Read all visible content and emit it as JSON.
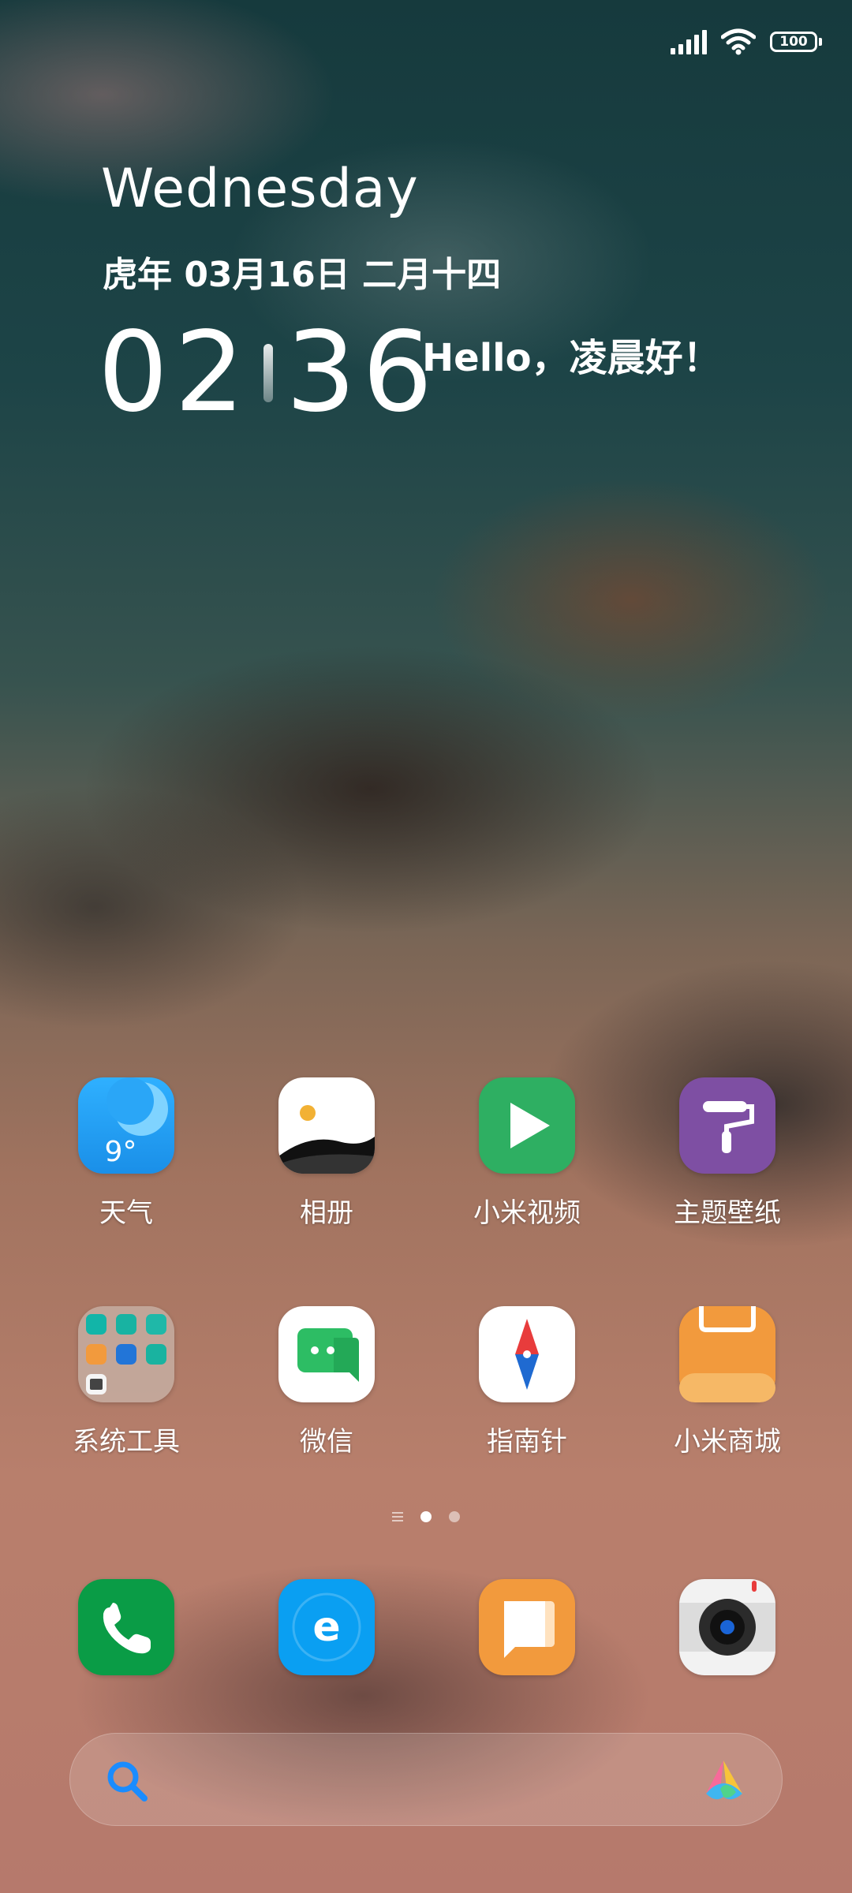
{
  "status_bar": {
    "battery_level": "100",
    "signal_strength_bars": 5,
    "wifi": "connected"
  },
  "clock_widget": {
    "weekday": "Wednesday",
    "date": "虎年 03月16日 二月十四",
    "hour": "02",
    "minute": "36",
    "greeting": "Hello，凌晨好！"
  },
  "apps": [
    {
      "id": "weather",
      "label": "天气",
      "badge": "9°",
      "icon": "weather-icon",
      "color": "#1e9cf0"
    },
    {
      "id": "gallery",
      "label": "相册",
      "icon": "gallery-icon",
      "color": "#ffffff"
    },
    {
      "id": "mi-video",
      "label": "小米视频",
      "icon": "play-icon",
      "color": "#2eaf62"
    },
    {
      "id": "themes",
      "label": "主题壁纸",
      "icon": "paint-roller-icon",
      "color": "#7e4fa3"
    },
    {
      "id": "system-tools",
      "label": "系统工具",
      "icon": "folder-icon",
      "color": "#b8a39a"
    },
    {
      "id": "wechat",
      "label": "微信",
      "icon": "wechat-icon",
      "color": "#2dbd64"
    },
    {
      "id": "compass",
      "label": "指南针",
      "icon": "compass-icon",
      "color": "#ffffff"
    },
    {
      "id": "mi-store",
      "label": "小米商城",
      "icon": "shopping-bag-icon",
      "color": "#f29a3d"
    }
  ],
  "dock": [
    {
      "id": "phone",
      "icon": "phone-icon",
      "color": "#0a9c46"
    },
    {
      "id": "browser",
      "icon": "browser-icon",
      "badge": "e",
      "color": "#0a9ff2"
    },
    {
      "id": "messages",
      "icon": "messages-icon",
      "color": "#f29a3d"
    },
    {
      "id": "camera",
      "icon": "camera-icon",
      "color": "#f0f0f0"
    }
  ],
  "page_indicator": {
    "pages": 2,
    "current_page": 1
  },
  "search_bar": {
    "placeholder": ""
  }
}
